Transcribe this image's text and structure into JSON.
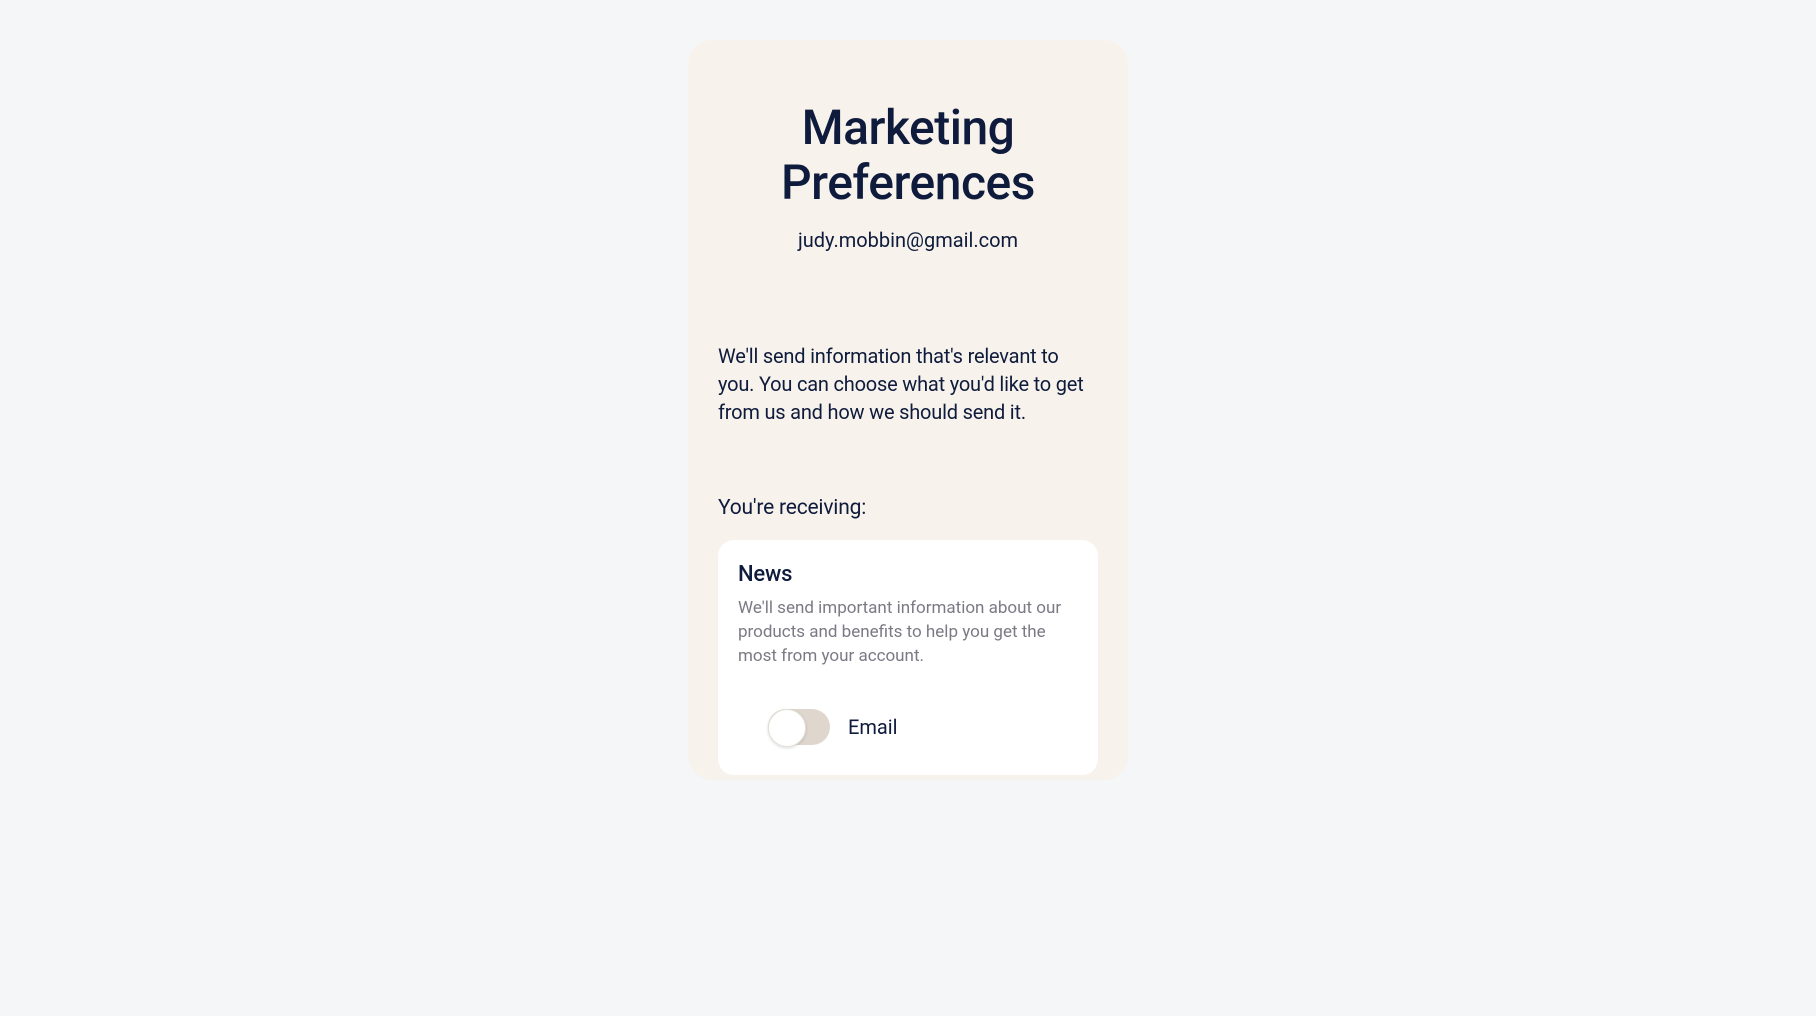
{
  "page": {
    "title": "Marketing Preferences",
    "email": "judy.mobbin@gmail.com",
    "description": "We'll send information that's relevant to you. You can choose what you'd like to get from us and how we should send it.",
    "section_label": "You're receiving:"
  },
  "preferences": [
    {
      "title": "News",
      "description": "We'll send important information about our products and benefits to help you get the most from your account.",
      "channels": [
        {
          "label": "Email",
          "enabled": false
        }
      ]
    }
  ]
}
